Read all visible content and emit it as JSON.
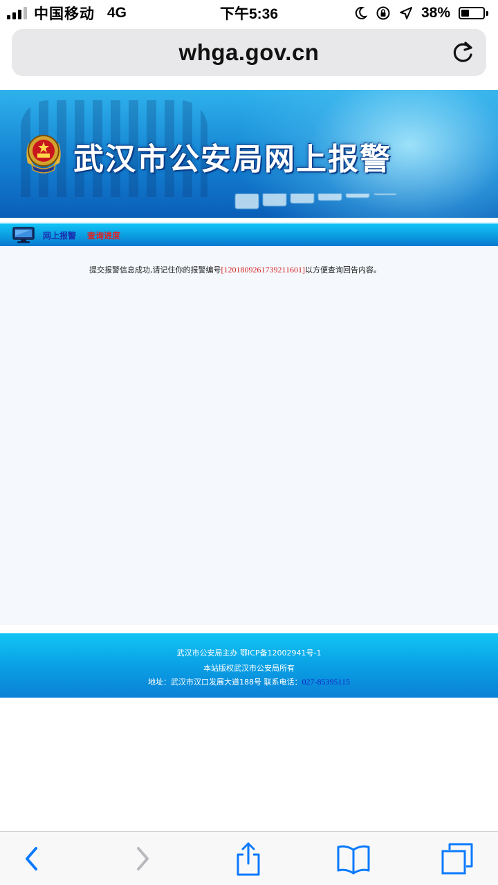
{
  "status_bar": {
    "carrier": "中国移动",
    "network": "4G",
    "time": "下午5:36",
    "battery_percent": "38%",
    "battery_level": 0.38
  },
  "address_bar": {
    "url": "whga.gov.cn"
  },
  "banner": {
    "title": "武汉市公安局网上报警"
  },
  "nav": {
    "items": [
      {
        "label": "网上报警"
      },
      {
        "label": "查询进度"
      }
    ]
  },
  "main": {
    "message_prefix": "提交报警信息成功,请记住你的报警编号",
    "report_number": "[12018092617392116​01]",
    "message_suffix": "以方便查询回告内容。"
  },
  "footer": {
    "line1": "武汉市公安局主办 鄂ICP备12002941号-1",
    "line2": "本站版权武汉市公安局所有",
    "line3_prefix": "地址：武汉市汉口发展大道188号 联系电话：",
    "phone": "027-85395115"
  },
  "colors": {
    "accent_blue": "#007aff",
    "nav_report": "#1a2fae",
    "nav_progress": "#e02020",
    "report_number": "#d22222",
    "footer_phone": "#1624c7"
  },
  "icons": {
    "back": "chevron-left-icon",
    "forward": "chevron-right-icon",
    "share": "share-icon",
    "bookmarks": "book-icon",
    "tabs": "tabs-icon",
    "reload": "reload-icon"
  }
}
